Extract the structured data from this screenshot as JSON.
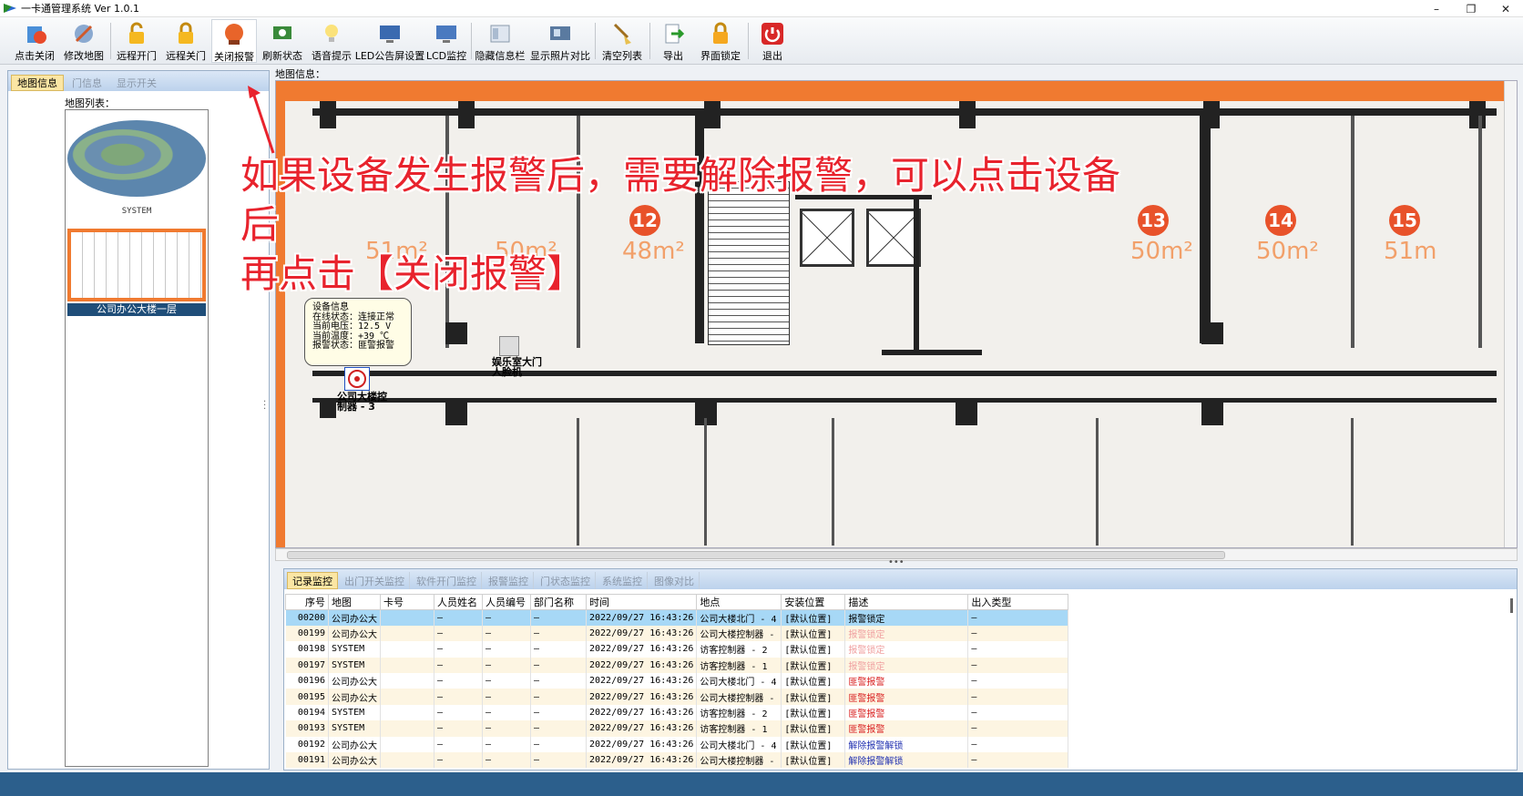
{
  "window": {
    "title": "一卡通管理系统  Ver 1.0.1",
    "minimize": "–",
    "maximize": "❐",
    "close": "✕"
  },
  "toolbar": {
    "buttons": [
      {
        "label": "点击关闭"
      },
      {
        "label": "修改地图"
      },
      {
        "label": "远程开门"
      },
      {
        "label": "远程关门"
      },
      {
        "label": "关闭报警"
      },
      {
        "label": "刷新状态"
      },
      {
        "label": "语音提示"
      },
      {
        "label": "LED公告屏设置"
      },
      {
        "label": "LCD监控"
      },
      {
        "label": "隐藏信息栏"
      },
      {
        "label": "显示照片对比"
      },
      {
        "label": "清空列表"
      },
      {
        "label": "导出"
      },
      {
        "label": "界面锁定"
      },
      {
        "label": "退出"
      }
    ],
    "active_index": 4
  },
  "left_panel": {
    "tabs": [
      {
        "label": "地图信息"
      },
      {
        "label": "门信息"
      },
      {
        "label": "显示开关"
      }
    ],
    "map_list_label": "地图列表：",
    "maps": [
      {
        "caption": "SYSTEM"
      },
      {
        "caption": "公司办公大楼一层"
      }
    ]
  },
  "map": {
    "label": "地图信息：",
    "rooms": [
      {
        "area": "51m²"
      },
      {
        "area": "50m²"
      },
      {
        "num": "12",
        "area": "48m²"
      },
      {
        "num": "13",
        "area": "50m²"
      },
      {
        "num": "14",
        "area": "50m²"
      },
      {
        "num": "15",
        "area": "51m"
      }
    ],
    "device_info": {
      "lines": [
        "设备信息",
        "在线状态：连接正常",
        "当前电压：12.5 V",
        "当前温度：+39 ℃",
        "报警状态：匪警报警"
      ]
    },
    "controller_label": "公司大楼控制器 - 3",
    "camera_label": "娱乐室大门人脸机"
  },
  "annotation": {
    "line1": "如果设备发生报警后，需要解除报警，可以点击设备后",
    "line2": "再点击【关闭报警】"
  },
  "monitor": {
    "tabs": [
      {
        "label": "记录监控"
      },
      {
        "label": "出门开关监控"
      },
      {
        "label": "软件开门监控"
      },
      {
        "label": "报警监控"
      },
      {
        "label": "门状态监控"
      },
      {
        "label": "系统监控"
      },
      {
        "label": "图像对比"
      }
    ],
    "columns": [
      "序号",
      "地图",
      "卡号",
      "人员姓名",
      "人员编号",
      "部门名称",
      "时间",
      "地点",
      "安装位置",
      "描述",
      "出入类型"
    ],
    "rows": [
      {
        "no": "00200",
        "map": "公司办公大",
        "card": "",
        "name": "–",
        "pid": "–",
        "dept": "–",
        "time": "2022/09/27 16:43:26",
        "place": "公司大楼北门 - 4",
        "loc": "[默认位置]",
        "desc": "报警锁定",
        "desc_type": "normal",
        "io": "–",
        "style": "sel"
      },
      {
        "no": "00199",
        "map": "公司办公大",
        "card": "",
        "name": "–",
        "pid": "–",
        "dept": "–",
        "time": "2022/09/27 16:43:26",
        "place": "公司大楼控制器 -",
        "loc": "[默认位置]",
        "desc": "报警锁定",
        "desc_type": "lockfaded",
        "io": "–",
        "style": "alt"
      },
      {
        "no": "00198",
        "map": "SYSTEM",
        "card": "",
        "name": "–",
        "pid": "–",
        "dept": "–",
        "time": "2022/09/27 16:43:26",
        "place": "访客控制器 - 2",
        "loc": "[默认位置]",
        "desc": "报警锁定",
        "desc_type": "lockfaded",
        "io": "–",
        "style": ""
      },
      {
        "no": "00197",
        "map": "SYSTEM",
        "card": "",
        "name": "–",
        "pid": "–",
        "dept": "–",
        "time": "2022/09/27 16:43:26",
        "place": "访客控制器 - 1",
        "loc": "[默认位置]",
        "desc": "报警锁定",
        "desc_type": "lockfaded",
        "io": "–",
        "style": "alt"
      },
      {
        "no": "00196",
        "map": "公司办公大",
        "card": "",
        "name": "–",
        "pid": "–",
        "dept": "–",
        "time": "2022/09/27 16:43:26",
        "place": "公司大楼北门 - 4",
        "loc": "[默认位置]",
        "desc": "匪警报警",
        "desc_type": "alarm",
        "io": "–",
        "style": ""
      },
      {
        "no": "00195",
        "map": "公司办公大",
        "card": "",
        "name": "–",
        "pid": "–",
        "dept": "–",
        "time": "2022/09/27 16:43:26",
        "place": "公司大楼控制器 -",
        "loc": "[默认位置]",
        "desc": "匪警报警",
        "desc_type": "alarm",
        "io": "–",
        "style": "alt"
      },
      {
        "no": "00194",
        "map": "SYSTEM",
        "card": "",
        "name": "–",
        "pid": "–",
        "dept": "–",
        "time": "2022/09/27 16:43:26",
        "place": "访客控制器 - 2",
        "loc": "[默认位置]",
        "desc": "匪警报警",
        "desc_type": "alarm",
        "io": "–",
        "style": ""
      },
      {
        "no": "00193",
        "map": "SYSTEM",
        "card": "",
        "name": "–",
        "pid": "–",
        "dept": "–",
        "time": "2022/09/27 16:43:26",
        "place": "访客控制器 - 1",
        "loc": "[默认位置]",
        "desc": "匪警报警",
        "desc_type": "alarm",
        "io": "–",
        "style": "alt"
      },
      {
        "no": "00192",
        "map": "公司办公大",
        "card": "",
        "name": "–",
        "pid": "–",
        "dept": "–",
        "time": "2022/09/27 16:43:26",
        "place": "公司大楼北门 - 4",
        "loc": "[默认位置]",
        "desc": "解除报警解锁",
        "desc_type": "unlock",
        "io": "–",
        "style": ""
      },
      {
        "no": "00191",
        "map": "公司办公大",
        "card": "",
        "name": "–",
        "pid": "–",
        "dept": "–",
        "time": "2022/09/27 16:43:26",
        "place": "公司大楼控制器 -",
        "loc": "[默认位置]",
        "desc": "解除报警解锁",
        "desc_type": "unlock",
        "io": "–",
        "style": "alt"
      }
    ]
  }
}
